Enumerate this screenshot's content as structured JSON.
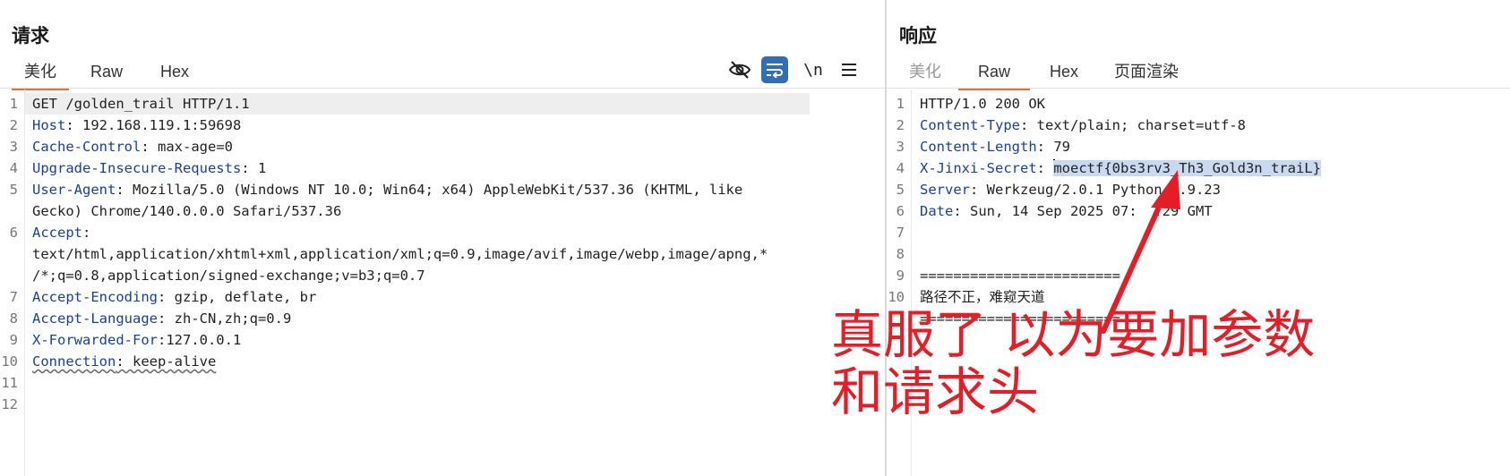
{
  "request": {
    "title": "请求",
    "tabs": [
      {
        "label": "美化",
        "active": true
      },
      {
        "label": "Raw",
        "active": false
      },
      {
        "label": "Hex",
        "active": false
      }
    ],
    "toolbar": {
      "icons": [
        "eye-off-icon",
        "wrap-icon",
        "newline-icon",
        "menu-icon"
      ],
      "newline_label": "\\n"
    },
    "lines": [
      {
        "n": "1",
        "key": "",
        "val": "GET /golden_trail HTTP/1.1"
      },
      {
        "n": "2",
        "key": "Host",
        "val": ": 192.168.119.1:59698"
      },
      {
        "n": "3",
        "key": "Cache-Control",
        "val": ": max-age=0"
      },
      {
        "n": "4",
        "key": "Upgrade-Insecure-Requests",
        "val": ": 1"
      },
      {
        "n": "5",
        "key": "User-Agent",
        "val": ": Mozilla/5.0 (Windows NT 10.0; Win64; x64) AppleWebKit/537.36 (KHTML, like"
      },
      {
        "n": "",
        "key": "",
        "val": "Gecko) Chrome/140.0.0.0 Safari/537.36"
      },
      {
        "n": "6",
        "key": "Accept",
        "val": ":"
      },
      {
        "n": "",
        "key": "",
        "val": "text/html,application/xhtml+xml,application/xml;q=0.9,image/avif,image/webp,image/apng,*"
      },
      {
        "n": "",
        "key": "",
        "val": "/*;q=0.8,application/signed-exchange;v=b3;q=0.7"
      },
      {
        "n": "7",
        "key": "Accept-Encoding",
        "val": ": gzip, deflate, br"
      },
      {
        "n": "8",
        "key": "Accept-Language",
        "val": ": zh-CN,zh;q=0.9"
      },
      {
        "n": "9",
        "key": "X-Forwarded-For",
        "val": ":127.0.0.1"
      },
      {
        "n": "10",
        "key": "Connection",
        "val": ": keep-alive"
      },
      {
        "n": "11",
        "key": "",
        "val": ""
      },
      {
        "n": "12",
        "key": "",
        "val": ""
      }
    ]
  },
  "response": {
    "title": "响应",
    "tabs": [
      {
        "label": "美化",
        "active": false
      },
      {
        "label": "Raw",
        "active": true
      },
      {
        "label": "Hex",
        "active": false
      },
      {
        "label": "页面渲染",
        "active": false
      }
    ],
    "lines": [
      {
        "n": "1",
        "key": "",
        "val": "HTTP/1.0 200 OK"
      },
      {
        "n": "2",
        "key": "Content-Type",
        "val": ": text/plain; charset=utf-8"
      },
      {
        "n": "3",
        "key": "Content-Length",
        "val": ": 79"
      },
      {
        "n": "4",
        "key": "X-Jinxi-Secret",
        "val": ": ",
        "selected": "moectf{0bs3rv3_Th3_Gold3n_traiL}"
      },
      {
        "n": "5",
        "key": "Server",
        "val": ": Werkzeug/2.0.1 Python/3.9.23"
      },
      {
        "n": "6",
        "key": "Date",
        "val": ": Sun, 14 Sep 2025 07:  :29 GMT"
      },
      {
        "n": "7",
        "key": "",
        "val": ""
      },
      {
        "n": "8",
        "key": "",
        "val": ""
      },
      {
        "n": "9",
        "key": "",
        "val": "========================"
      },
      {
        "n": "10",
        "key": "",
        "val": "路径不正，难窥天道"
      },
      {
        "n": "",
        "key": "",
        "val": "========================"
      }
    ]
  },
  "annotation": {
    "text_line1": "真服了 以为要加参数",
    "text_line2": "和请求头",
    "color": "#e51d26"
  }
}
